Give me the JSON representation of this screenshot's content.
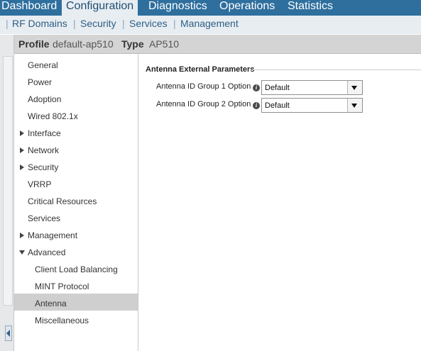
{
  "top_tabs": [
    {
      "label": "Dashboard",
      "active": false
    },
    {
      "label": "Configuration",
      "active": true
    },
    {
      "label": "Diagnostics",
      "active": false
    },
    {
      "label": "Operations",
      "active": false
    },
    {
      "label": "Statistics",
      "active": false
    }
  ],
  "sub_tabs": [
    "RF Domains",
    "Security",
    "Services",
    "Management"
  ],
  "profile_bar": {
    "profile_key": "Profile",
    "profile_value": "default-ap510",
    "type_key": "Type",
    "type_value": "AP510"
  },
  "tree": [
    {
      "label": "General",
      "expander": "none",
      "indent": 0,
      "selected": false
    },
    {
      "label": "Power",
      "expander": "none",
      "indent": 0,
      "selected": false
    },
    {
      "label": "Adoption",
      "expander": "none",
      "indent": 0,
      "selected": false
    },
    {
      "label": "Wired 802.1x",
      "expander": "none",
      "indent": 0,
      "selected": false
    },
    {
      "label": "Interface",
      "expander": "collapsed",
      "indent": 0,
      "selected": false
    },
    {
      "label": "Network",
      "expander": "collapsed",
      "indent": 0,
      "selected": false
    },
    {
      "label": "Security",
      "expander": "collapsed",
      "indent": 0,
      "selected": false
    },
    {
      "label": "VRRP",
      "expander": "none",
      "indent": 0,
      "selected": false
    },
    {
      "label": "Critical Resources",
      "expander": "none",
      "indent": 0,
      "selected": false
    },
    {
      "label": "Services",
      "expander": "none",
      "indent": 0,
      "selected": false
    },
    {
      "label": "Management",
      "expander": "collapsed",
      "indent": 0,
      "selected": false
    },
    {
      "label": "Advanced",
      "expander": "expanded",
      "indent": 0,
      "selected": false
    },
    {
      "label": "Client Load Balancing",
      "expander": "none",
      "indent": 1,
      "selected": false
    },
    {
      "label": "MINT Protocol",
      "expander": "none",
      "indent": 1,
      "selected": false
    },
    {
      "label": "Antenna",
      "expander": "none",
      "indent": 1,
      "selected": true
    },
    {
      "label": "Miscellaneous",
      "expander": "none",
      "indent": 1,
      "selected": false
    }
  ],
  "main": {
    "section_title": "Antenna External Parameters",
    "fields": [
      {
        "label": "Antenna ID Group 1 Option",
        "value": "Default"
      },
      {
        "label": "Antenna ID Group 2 Option",
        "value": "Default"
      }
    ]
  },
  "colors": {
    "top_nav": "#2e6f9e",
    "sub_nav": "#e8edf2",
    "selected_item": "#cfcfcf"
  }
}
